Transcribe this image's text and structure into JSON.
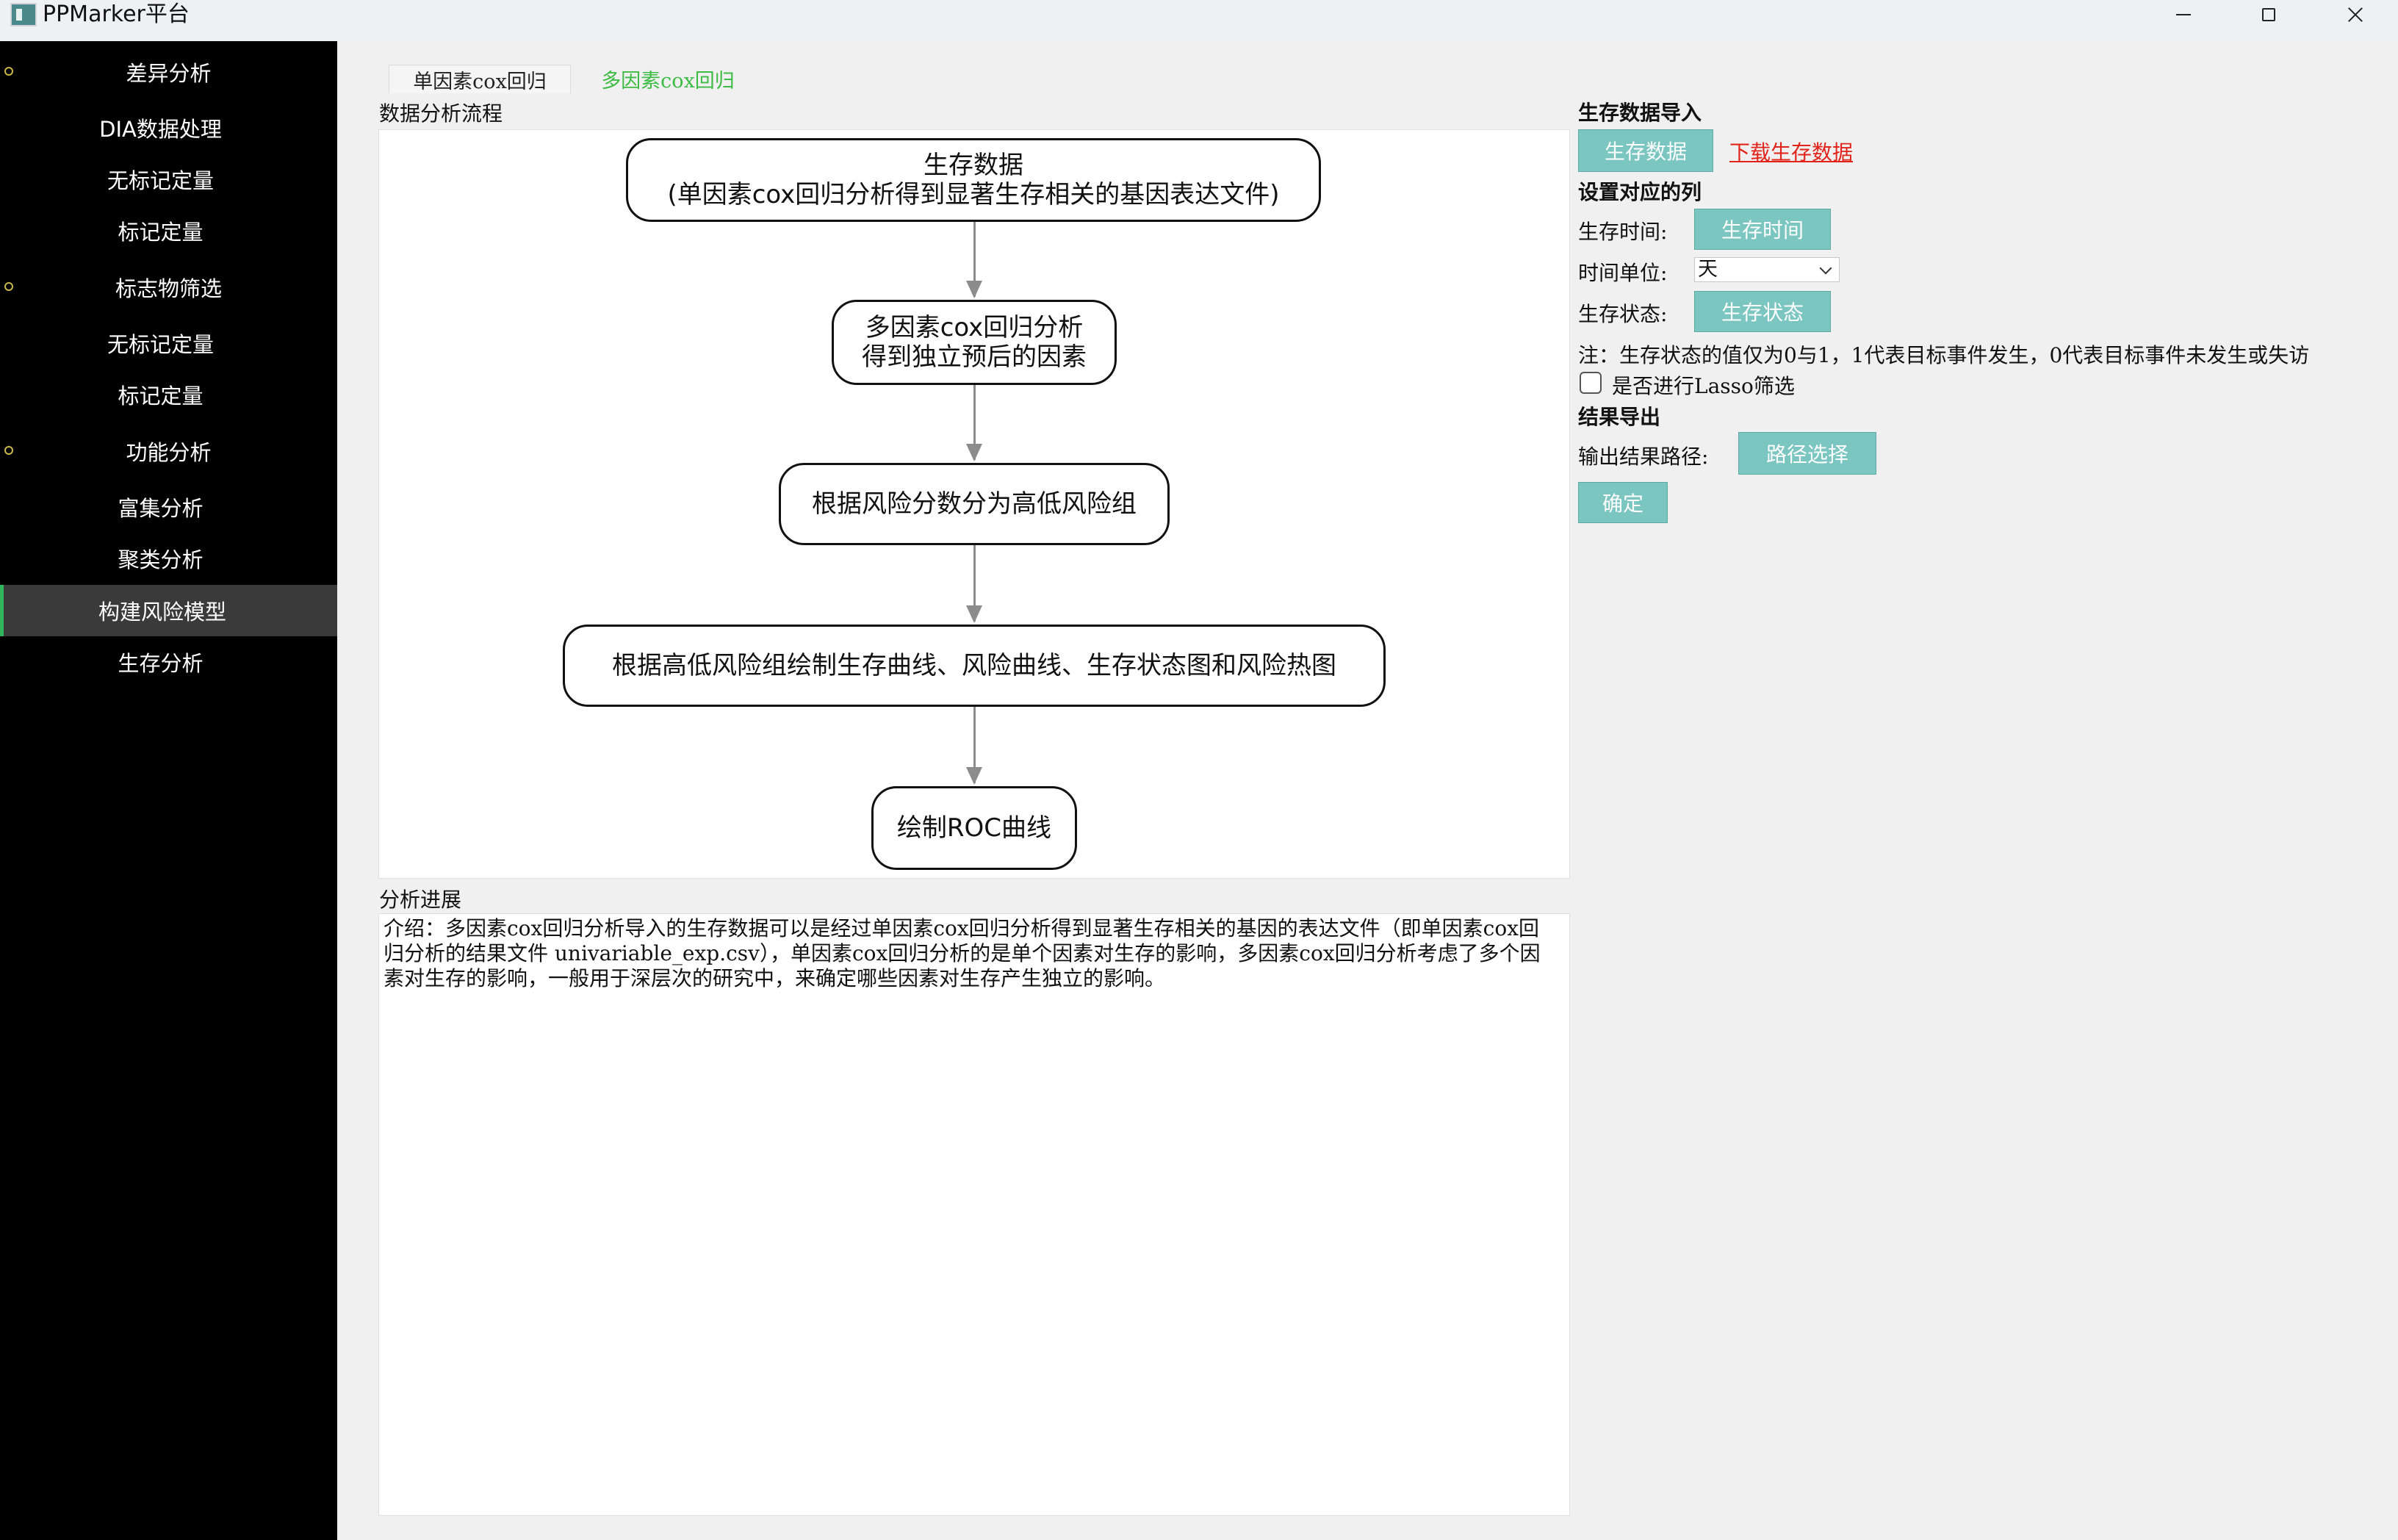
{
  "window": {
    "title": "PPMarker平台"
  },
  "sidebar": {
    "items": [
      {
        "label": "差异分析",
        "group": true
      },
      {
        "label": "DIA数据处理"
      },
      {
        "label": "无标记定量"
      },
      {
        "label": "标记定量"
      },
      {
        "label": "标志物筛选",
        "group": true
      },
      {
        "label": "无标记定量"
      },
      {
        "label": "标记定量"
      },
      {
        "label": "功能分析",
        "group": true
      },
      {
        "label": "富集分析"
      },
      {
        "label": "聚类分析"
      },
      {
        "label": "构建风险模型",
        "active": true
      },
      {
        "label": "生存分析"
      }
    ]
  },
  "tabs": [
    {
      "label": "单因素cox回归"
    },
    {
      "label": "多因素cox回归",
      "active": true
    }
  ],
  "workflow": {
    "label": "数据分析流程",
    "nodes": [
      {
        "line1": "生存数据",
        "line2": "(单因素cox回归分析得到显著生存相关的基因表达文件)"
      },
      {
        "line1": "多因素cox回归分析",
        "line2": "得到独立预后的因素"
      },
      {
        "line1": "根据风险分数分为高低风险组"
      },
      {
        "line1": "根据高低风险组绘制生存曲线、风险曲线、生存状态图和风险热图"
      },
      {
        "line1": "绘制ROC曲线"
      }
    ]
  },
  "progress": {
    "label": "分析进展",
    "intro": "介绍：多因素cox回归分析导入的生存数据可以是经过单因素cox回归分析得到显著生存相关的基因的表达文件（即单因素cox回归分析的结果文件 univariable_exp.csv），单因素cox回归分析的是单个因素对生存的影响，多因素cox回归分析考虑了多个因素对生存的影响，一般用于深层次的研究中，来确定哪些因素对生存产生独立的影响。"
  },
  "right": {
    "import_title": "生存数据导入",
    "import_button": "生存数据",
    "download_link": "下载生存数据",
    "columns_title": "设置对应的列",
    "time_label": "生存时间:",
    "time_button": "生存时间",
    "unit_label": "时间单位:",
    "unit_value": "天",
    "status_label": "生存状态:",
    "status_button": "生存状态",
    "note": "注：生存状态的值仅为0与1，1代表目标事件发生，0代表目标事件未发生或失访",
    "lasso_label": "是否进行Lasso筛选",
    "lasso_checked": false,
    "export_title": "结果导出",
    "output_label": "输出结果路径:",
    "path_button": "路径选择",
    "confirm_button": "确定"
  },
  "colors": {
    "accent": "#7bc6c0",
    "active_tab": "#3dbb43",
    "link": "#e2231a",
    "sidebar_bg": "#000000"
  }
}
